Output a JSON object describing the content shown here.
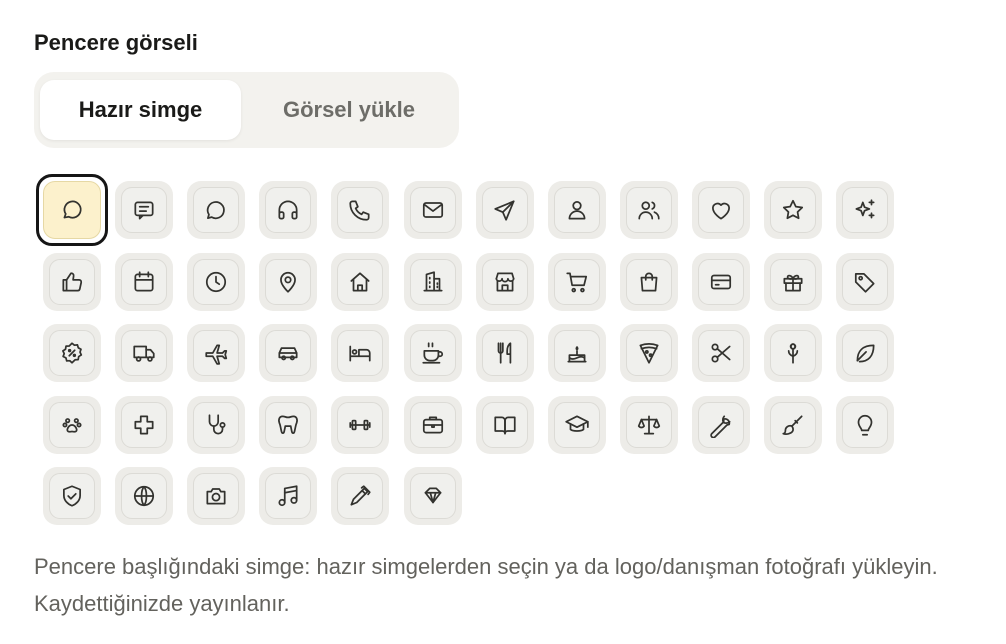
{
  "section_title": "Pencere görseli",
  "tabs": [
    {
      "label": "Hazır simge",
      "active": true
    },
    {
      "label": "Görsel yükle",
      "active": false
    }
  ],
  "selected_icon": "chat-bubble-icon",
  "icons": [
    "chat-bubble-icon",
    "chat-lines-icon",
    "chat-circle-icon",
    "headphones-icon",
    "phone-icon",
    "mail-icon",
    "send-icon",
    "user-icon",
    "users-icon",
    "heart-icon",
    "star-icon",
    "sparkles-icon",
    "thumbs-up-icon",
    "calendar-icon",
    "clock-icon",
    "map-pin-icon",
    "home-icon",
    "building-icon",
    "store-icon",
    "cart-icon",
    "shopping-bag-icon",
    "credit-card-icon",
    "gift-icon",
    "tag-icon",
    "discount-badge-icon",
    "truck-icon",
    "plane-icon",
    "car-icon",
    "bed-icon",
    "coffee-icon",
    "utensils-icon",
    "cake-icon",
    "pizza-icon",
    "scissors-icon",
    "flower-icon",
    "leaf-icon",
    "paw-icon",
    "medical-cross-icon",
    "stethoscope-icon",
    "tooth-icon",
    "dumbbell-icon",
    "briefcase-icon",
    "book-icon",
    "graduation-cap-icon",
    "scales-icon",
    "wrench-icon",
    "paintbrush-icon",
    "lightbulb-icon",
    "shield-check-icon",
    "globe-icon",
    "camera-icon",
    "music-icon",
    "pen-icon",
    "diamond-icon"
  ],
  "help_text": "Pencere başlığındaki simge: hazır simgelerden seçin ya da logo/danışman fotoğrafı yükleyin. Kaydettiğinizde yayınlanır.",
  "colors": {
    "selected_fill": "#fcf1cc",
    "tile_fill": "#f0f0ed",
    "text": "#1a1a18",
    "muted_text": "#63625d"
  }
}
